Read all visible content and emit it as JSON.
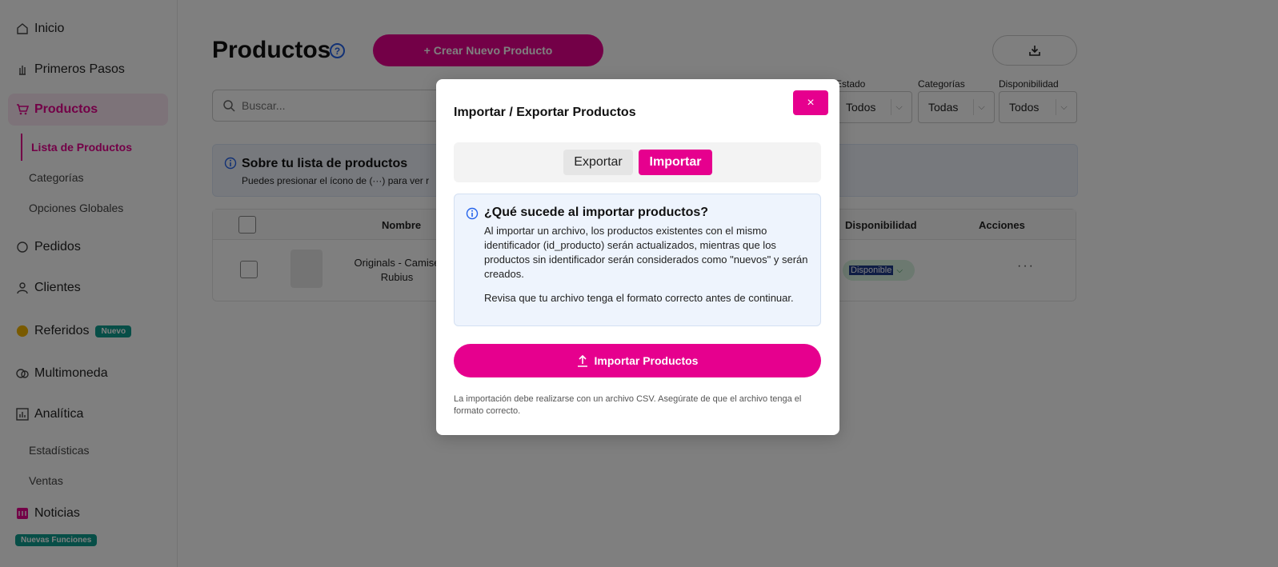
{
  "sidebar": {
    "items": [
      {
        "label": "Inicio",
        "icon": "home-icon"
      },
      {
        "label": "Primeros Pasos",
        "icon": "hand-icon"
      },
      {
        "label": "Productos",
        "icon": "cart-icon"
      },
      {
        "label": "Pedidos",
        "icon": "orders-icon"
      },
      {
        "label": "Clientes",
        "icon": "user-icon"
      },
      {
        "label": "Referidos",
        "icon": "referral-icon",
        "badge": "Nuevo"
      },
      {
        "label": "Multimoneda",
        "icon": "currency-icon"
      },
      {
        "label": "Analítica",
        "icon": "chart-icon"
      },
      {
        "label": "Noticias",
        "icon": "news-icon",
        "badge": "Nuevas Funciones"
      }
    ],
    "product_subitems": [
      "Lista de Productos",
      "Categorías",
      "Opciones Globales"
    ],
    "analytics_subitems": [
      "Estadísticas",
      "Ventas"
    ]
  },
  "header": {
    "title": "Productos",
    "help": "?",
    "create_label": "+ Crear Nuevo Producto"
  },
  "search": {
    "placeholder": "Buscar..."
  },
  "filters": {
    "estado": {
      "label": "Estado",
      "value": "Todos"
    },
    "categorias": {
      "label": "Categorías",
      "value": "Todas"
    },
    "disponibilidad": {
      "label": "Disponibilidad",
      "value": "Todos"
    }
  },
  "info": {
    "title": "Sobre tu lista de productos",
    "text": "Puedes presionar el ícono de (···) para ver r"
  },
  "table": {
    "headers": {
      "name": "Nombre",
      "availability": "Disponibilidad",
      "actions": "Acciones"
    },
    "rows": [
      {
        "name": "Originals - Camise Rubius",
        "availability": "Disponible",
        "actions": "···"
      }
    ]
  },
  "modal": {
    "title": "Importar / Exportar Productos",
    "close": "×",
    "tabs": {
      "export": "Exportar",
      "import": "Importar"
    },
    "info_title": "¿Qué sucede al importar productos?",
    "info_p1": "Al importar un archivo, los productos existentes con el mismo identificador (id_producto) serán actualizados, mientras que los productos sin identificador serán considerados como \"nuevos\" y serán creados.",
    "info_p2": "Revisa que tu archivo tenga el formato correcto antes de continuar.",
    "import_button": "Importar Productos",
    "footnote": "La importación debe realizarse con un archivo CSV. Asegúrate de que el archivo tenga el formato correcto."
  },
  "colors": {
    "accent": "#e6008e",
    "info_blue": "#2563eb",
    "badge_teal": "#0f9d8f"
  }
}
